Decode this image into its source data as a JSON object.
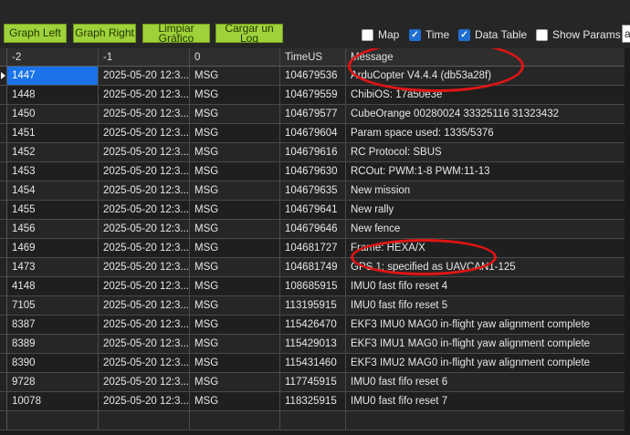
{
  "toolbar": {
    "buttons": [
      {
        "label_line1": "Graph Left",
        "label_line2": ""
      },
      {
        "label_line1": "Graph Right",
        "label_line2": ""
      },
      {
        "label_line1": "Limpiar",
        "label_line2": "Gráfico"
      },
      {
        "label_line1": "Cargar un",
        "label_line2": "Log"
      }
    ],
    "checkboxes": [
      {
        "label": "Map",
        "checked": false
      },
      {
        "label": "Time",
        "checked": true
      },
      {
        "label": "Data Table",
        "checked": true
      },
      {
        "label": "Show Params",
        "checked": false
      }
    ],
    "cut_input_text": "a"
  },
  "table": {
    "columns": [
      "-2",
      "-1",
      "0",
      "TimeUS",
      "Message"
    ],
    "rows": [
      {
        "c1": "1447",
        "c2": "2025-05-20 12:3...",
        "c3": "MSG",
        "c4": "104679536",
        "c5": "ArduCopter V4.4.4 (db53a28f)"
      },
      {
        "c1": "1448",
        "c2": "2025-05-20 12:3...",
        "c3": "MSG",
        "c4": "104679559",
        "c5": "ChibiOS: 17a50e3e"
      },
      {
        "c1": "1450",
        "c2": "2025-05-20 12:3...",
        "c3": "MSG",
        "c4": "104679577",
        "c5": "CubeOrange 00280024 33325116 31323432"
      },
      {
        "c1": "1451",
        "c2": "2025-05-20 12:3...",
        "c3": "MSG",
        "c4": "104679604",
        "c5": "Param space used: 1335/5376"
      },
      {
        "c1": "1452",
        "c2": "2025-05-20 12:3...",
        "c3": "MSG",
        "c4": "104679616",
        "c5": "RC Protocol: SBUS"
      },
      {
        "c1": "1453",
        "c2": "2025-05-20 12:3...",
        "c3": "MSG",
        "c4": "104679630",
        "c5": "RCOut: PWM:1-8 PWM:11-13"
      },
      {
        "c1": "1454",
        "c2": "2025-05-20 12:3...",
        "c3": "MSG",
        "c4": "104679635",
        "c5": "New mission"
      },
      {
        "c1": "1455",
        "c2": "2025-05-20 12:3...",
        "c3": "MSG",
        "c4": "104679641",
        "c5": "New rally"
      },
      {
        "c1": "1456",
        "c2": "2025-05-20 12:3...",
        "c3": "MSG",
        "c4": "104679646",
        "c5": "New fence"
      },
      {
        "c1": "1469",
        "c2": "2025-05-20 12:3...",
        "c3": "MSG",
        "c4": "104681727",
        "c5": "Frame: HEXA/X"
      },
      {
        "c1": "1473",
        "c2": "2025-05-20 12:3...",
        "c3": "MSG",
        "c4": "104681749",
        "c5": "GPS 1: specified as UAVCAN1-125"
      },
      {
        "c1": "4148",
        "c2": "2025-05-20 12:3...",
        "c3": "MSG",
        "c4": "108685915",
        "c5": "IMU0 fast fifo reset 4"
      },
      {
        "c1": "7105",
        "c2": "2025-05-20 12:3...",
        "c3": "MSG",
        "c4": "113195915",
        "c5": "IMU0 fast fifo reset 5"
      },
      {
        "c1": "8387",
        "c2": "2025-05-20 12:3...",
        "c3": "MSG",
        "c4": "115426470",
        "c5": "EKF3 IMU0 MAG0 in-flight yaw alignment complete"
      },
      {
        "c1": "8389",
        "c2": "2025-05-20 12:3...",
        "c3": "MSG",
        "c4": "115429013",
        "c5": "EKF3 IMU1 MAG0 in-flight yaw alignment complete"
      },
      {
        "c1": "8390",
        "c2": "2025-05-20 12:3...",
        "c3": "MSG",
        "c4": "115431460",
        "c5": "EKF3 IMU2 MAG0 in-flight yaw alignment complete"
      },
      {
        "c1": "9728",
        "c2": "2025-05-20 12:3...",
        "c3": "MSG",
        "c4": "117745915",
        "c5": "IMU0 fast fifo reset 6"
      },
      {
        "c1": "10078",
        "c2": "2025-05-20 12:3...",
        "c3": "MSG",
        "c4": "118325915",
        "c5": "IMU0 fast fifo reset 7"
      },
      {
        "c1": "",
        "c2": "",
        "c3": "",
        "c4": "",
        "c5": ""
      }
    ]
  },
  "colors": {
    "button_green": "#9fd23a",
    "selection_blue": "#1a73e8",
    "annotation_red": "#e01414"
  }
}
